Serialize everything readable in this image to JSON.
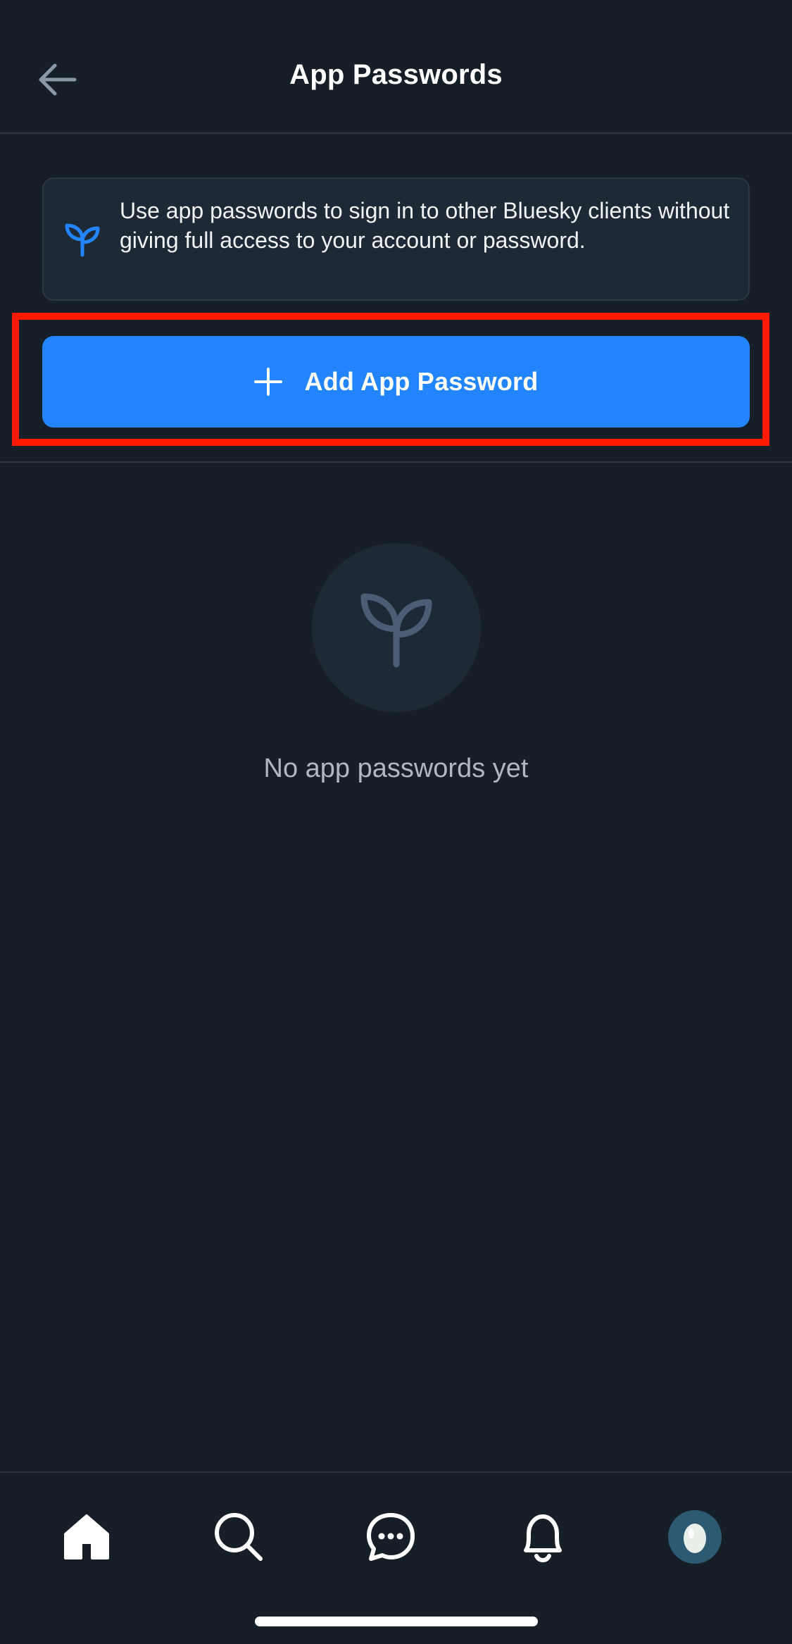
{
  "header": {
    "title": "App Passwords",
    "back_icon": "arrow-left-icon"
  },
  "info": {
    "icon": "seedling-icon",
    "text": "Use app passwords to sign in to other Bluesky clients without giving full access to your account or password."
  },
  "add_button": {
    "icon": "plus-icon",
    "label": "Add App Password"
  },
  "empty_state": {
    "icon": "seedling-icon",
    "text": "No app passwords yet"
  },
  "bottom_nav": {
    "items": [
      {
        "name": "home",
        "icon": "home-icon"
      },
      {
        "name": "search",
        "icon": "search-icon"
      },
      {
        "name": "messages",
        "icon": "chat-bubble-icon"
      },
      {
        "name": "notifications",
        "icon": "bell-icon"
      },
      {
        "name": "profile",
        "icon": "avatar-icon"
      }
    ]
  },
  "colors": {
    "background": "#161e27",
    "accent": "#2285ff",
    "highlight": "#ff1a00",
    "panel": "#1e2936",
    "muted_text": "#aeb7c2"
  }
}
